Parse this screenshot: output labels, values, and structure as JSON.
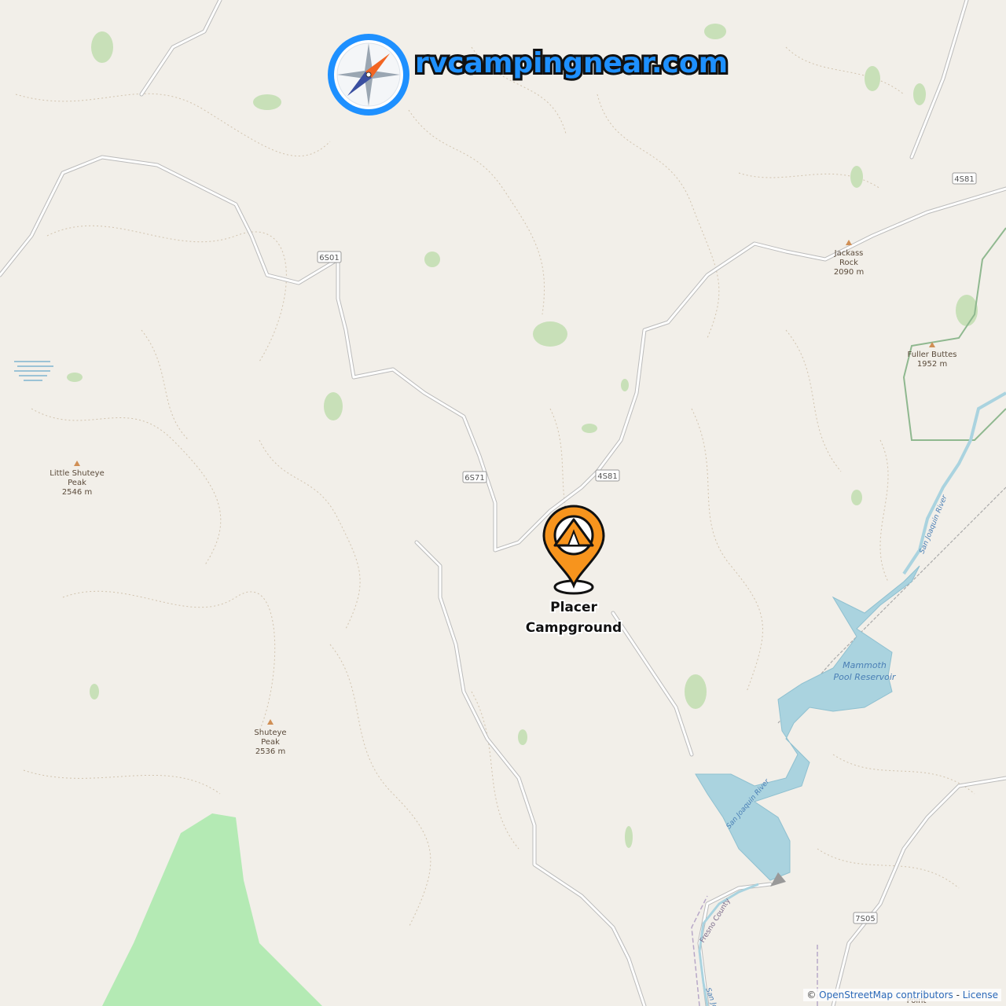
{
  "brand": {
    "name": "rvcampingnear.com",
    "logo_icon": "compass-icon"
  },
  "marker": {
    "icon": "tent-pin-icon",
    "label_line1": "Placer",
    "label_line2": "Campground",
    "color": "#f7941d"
  },
  "roads": [
    {
      "id": "6S01",
      "label": "6S01"
    },
    {
      "id": "6S71",
      "label": "6S71"
    },
    {
      "id": "4S81a",
      "label": "4S81"
    },
    {
      "id": "4S81b",
      "label": "4S81"
    },
    {
      "id": "7S05",
      "label": "7S05"
    }
  ],
  "peaks": [
    {
      "name_line1": "Jackass",
      "name_line2": "Rock",
      "elevation": "2090 m"
    },
    {
      "name_line1": "Fuller Buttes",
      "name_line2": "",
      "elevation": "1952 m"
    },
    {
      "name_line1": "Little Shuteye",
      "name_line2": "Peak",
      "elevation": "2546 m"
    },
    {
      "name_line1": "Shuteye",
      "name_line2": "Peak",
      "elevation": "2536 m"
    }
  ],
  "water": {
    "reservoir_line1": "Mammoth",
    "reservoir_line2": "Pool Reservoir",
    "river_upper": "San Joaquin River",
    "river_lower": "San Joaquin River",
    "river_bottom": "San Joa"
  },
  "county_label": "Fresno County",
  "bottom_place": "Point",
  "attribution": {
    "prefix": "© ",
    "osm": "OpenStreetMap contributors",
    "sep": " - ",
    "license": "License"
  },
  "colors": {
    "land": "#f2efe9",
    "forest": "#add19e",
    "water": "#aad3df",
    "road": "#ffffff",
    "contour": "#c9b9a0"
  }
}
